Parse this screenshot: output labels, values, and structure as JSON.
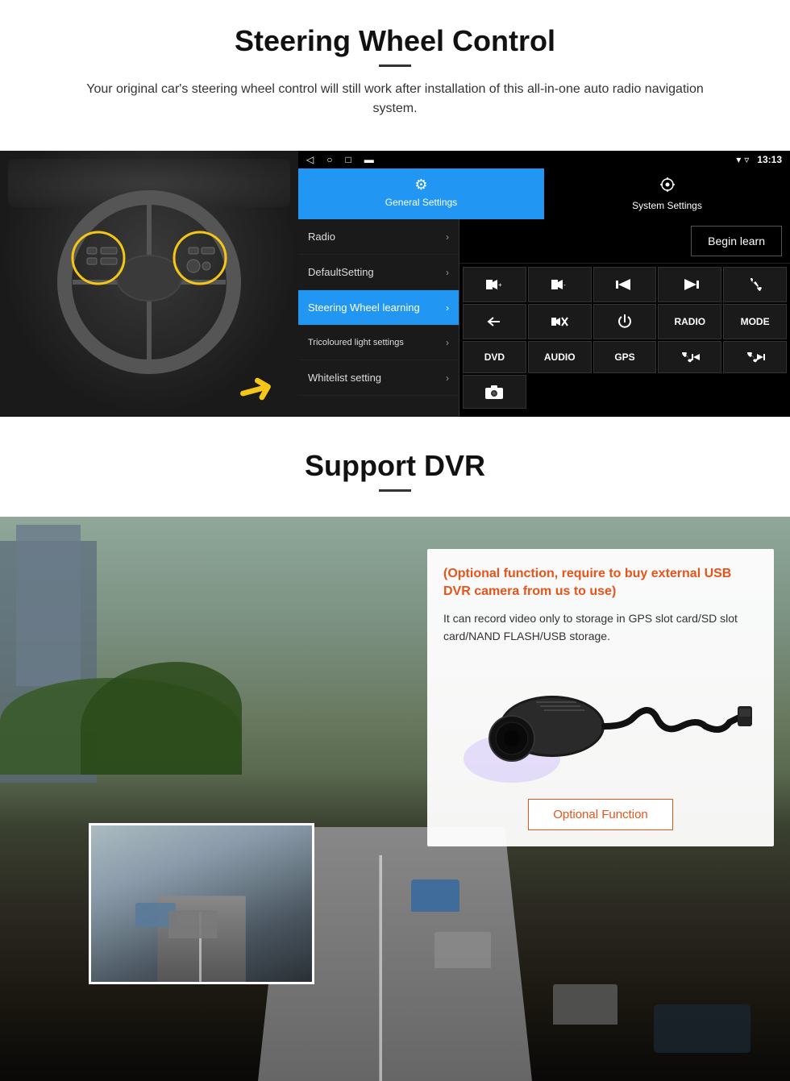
{
  "page": {
    "steering_section": {
      "title": "Steering Wheel Control",
      "subtitle": "Your original car's steering wheel control will still work after installation of this all-in-one auto radio navigation system.",
      "status_bar": {
        "time": "13:13",
        "signal_icon": "▾",
        "wifi_icon": "▾"
      },
      "tabs": [
        {
          "id": "general",
          "icon": "⚙",
          "label": "General Settings",
          "active": true
        },
        {
          "id": "system",
          "icon": "🔧",
          "label": "System Settings",
          "active": false
        }
      ],
      "menu_items": [
        {
          "label": "Radio",
          "active": false
        },
        {
          "label": "DefaultSetting",
          "active": false
        },
        {
          "label": "Steering Wheel learning",
          "active": true
        },
        {
          "label": "Tricoloured light settings",
          "active": false
        },
        {
          "label": "Whitelist setting",
          "active": false
        }
      ],
      "begin_learn_label": "Begin learn",
      "control_buttons": [
        "⏮+",
        "⏮-",
        "⏮",
        "⏭",
        "📞",
        "↩",
        "🔇",
        "⏻",
        "RADIO",
        "MODE",
        "DVD",
        "AUDIO",
        "GPS",
        "📞⏮",
        "🔀⏭",
        "📷"
      ]
    },
    "dvr_section": {
      "title": "Support DVR",
      "optional_text": "(Optional function, require to buy external USB DVR camera from us to use)",
      "description": "It can record video only to storage in GPS slot card/SD slot card/NAND FLASH/USB storage.",
      "optional_function_label": "Optional Function"
    }
  }
}
